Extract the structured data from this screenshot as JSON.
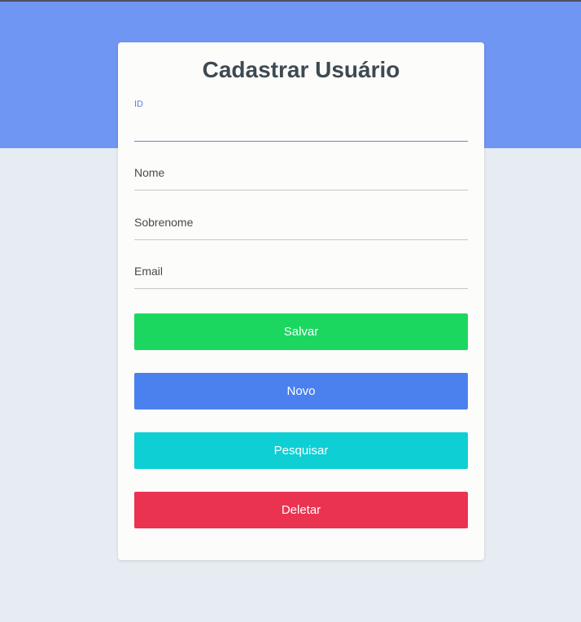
{
  "form": {
    "title": "Cadastrar Usuário",
    "fields": {
      "id": {
        "label": "ID",
        "value": ""
      },
      "nome": {
        "label": "Nome",
        "value": ""
      },
      "sobrenome": {
        "label": "Sobrenome",
        "value": ""
      },
      "email": {
        "label": "Email",
        "value": ""
      }
    },
    "buttons": {
      "salvar": {
        "label": "Salvar",
        "color": "#1bd760"
      },
      "novo": {
        "label": "Novo",
        "color": "#4a81ef"
      },
      "pesquisar": {
        "label": "Pesquisar",
        "color": "#0dcfd4"
      },
      "deletar": {
        "label": "Deletar",
        "color": "#ea3350"
      }
    }
  },
  "colors": {
    "header_band": "#6f96f2",
    "page_background": "#e6ecf2",
    "card_background": "#fcfcfb",
    "title": "#3e4a52",
    "active_label": "#5b7fd9"
  }
}
